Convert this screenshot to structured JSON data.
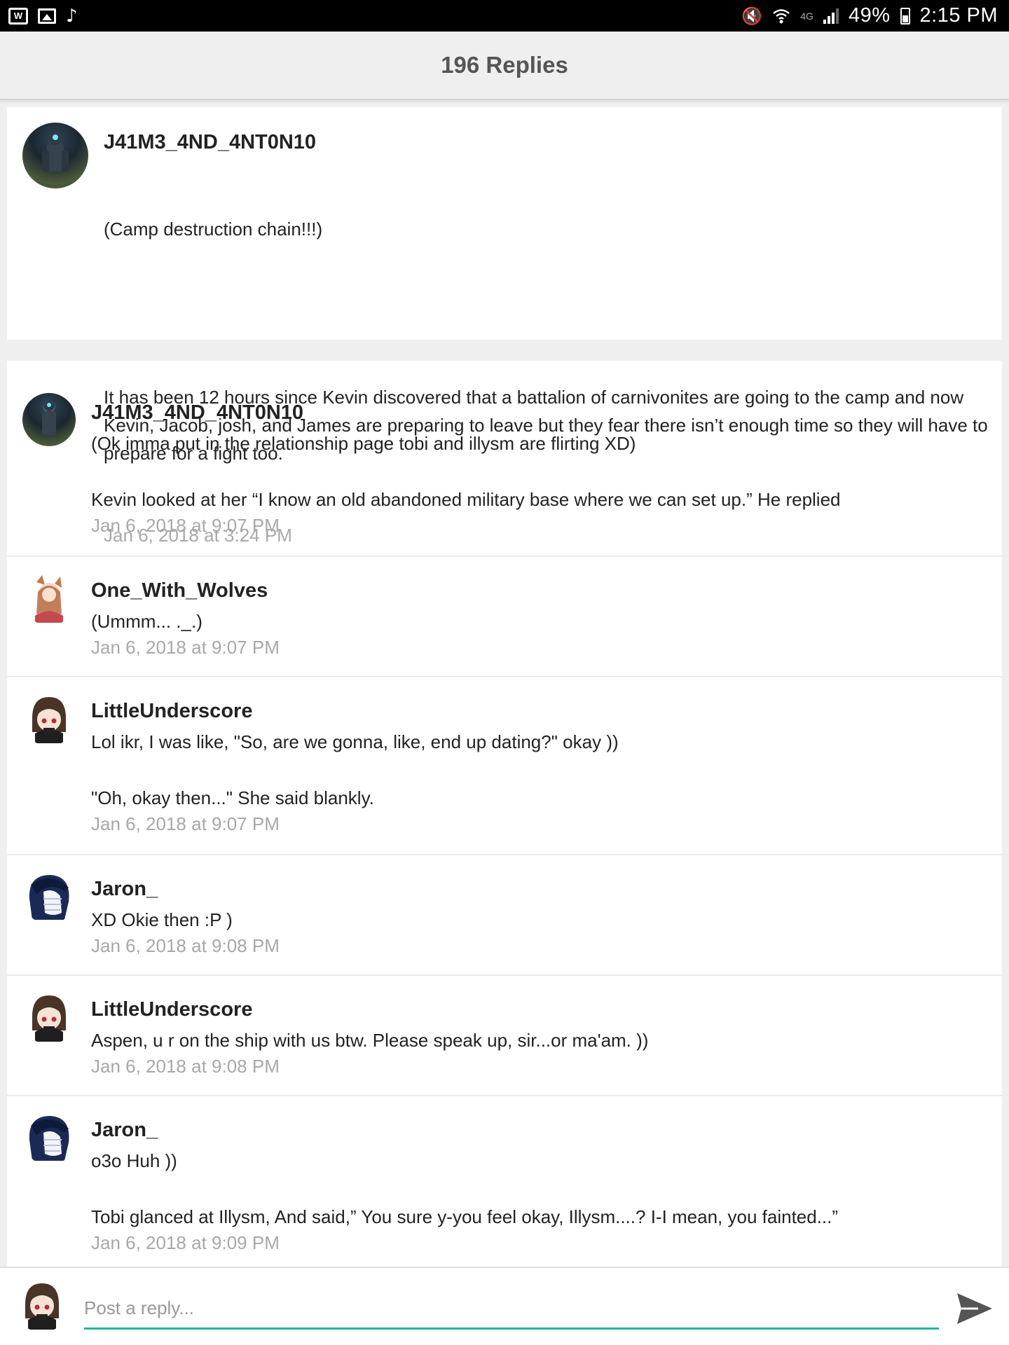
{
  "status_bar": {
    "battery": "49%",
    "time": "2:15 PM",
    "network": "4G",
    "battery_level": 0.49,
    "left_icons": [
      "app-icon",
      "gallery-icon",
      "music-note-icon"
    ],
    "right_icons": [
      "mute-icon",
      "wifi-icon",
      "signal-icon",
      "battery-icon"
    ]
  },
  "header": {
    "title": "196 Replies"
  },
  "main_post": {
    "author": "J41M3_4ND_4NT0N10",
    "lines": [
      "(Camp destruction chain!!!)",
      "",
      "It has been 12 hours since Kevin discovered that a battalion of carnivonites are going to the camp and now Kevin, Jacob, josh, and James are preparing to leave but they fear there isn’t enough time so they will have to prepare for a fight too."
    ],
    "timestamp": "Jan 6, 2018 at 3:24 PM"
  },
  "replies": [
    {
      "author": "J41M3_4ND_4NT0N10",
      "text": "(Ok imma put in the relationship page tobi and illysm are flirting XD)\n\nKevin looked at her “I know an old abandoned military base where we can set up.” He replied",
      "timestamp": "Jan 6, 2018 at 9:07 PM"
    },
    {
      "author": "One_With_Wolves",
      "text": "(Ummm... ._.)",
      "timestamp": "Jan 6, 2018 at 9:07 PM"
    },
    {
      "author": "LittleUnderscore",
      "text": "Lol ikr, I was like, \"So, are we gonna, like, end up dating?\" okay ))\n\n\"Oh, okay then...\" She said blankly.",
      "timestamp": "Jan 6, 2018 at 9:07 PM"
    },
    {
      "author": "Jaron_",
      "text": "XD Okie then :P )",
      "timestamp": "Jan 6, 2018 at 9:08 PM"
    },
    {
      "author": "LittleUnderscore",
      "text": "Aspen, u r on the ship with us btw. Please speak up, sir...or ma'am. ))",
      "timestamp": "Jan 6, 2018 at 9:08 PM"
    },
    {
      "author": "Jaron_",
      "text": "o3o Huh ))\n\nTobi glanced at Illysm, And said,” You sure y-you feel okay, Illysm....? I-I mean, you fainted...”",
      "timestamp": "Jan 6, 2018 at 9:09 PM"
    }
  ],
  "composer": {
    "placeholder": "Post a reply..."
  },
  "colors": {
    "accent": "#2ab3a6",
    "timestamp": "#a8a8a8",
    "header_bg": "#efefef"
  }
}
